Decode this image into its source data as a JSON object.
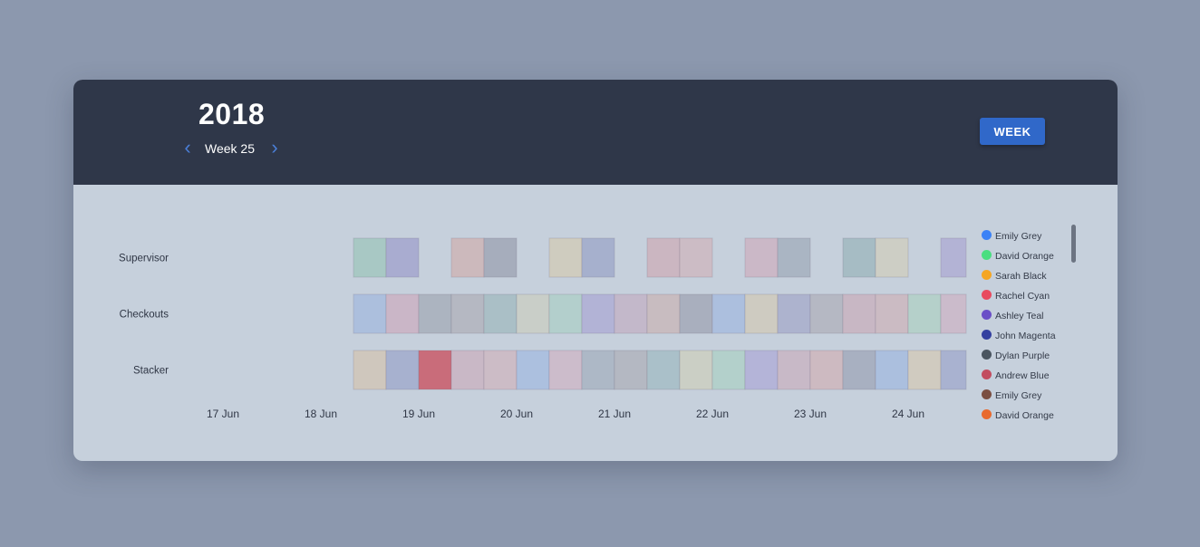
{
  "header": {
    "year": "2018",
    "week_label": "Week 25",
    "prev_icon": "chevron-left-icon",
    "next_icon": "chevron-right-icon",
    "view_button": "WEEK"
  },
  "colors": {
    "background": "#8c98ae",
    "header_bg": "#2f3749",
    "panel_bg": "#c6d0dc",
    "accent": "#3068c9"
  },
  "legend": {
    "items": [
      {
        "name": "Emily Grey",
        "color": "#3b82f6"
      },
      {
        "name": "David Orange",
        "color": "#4ade80"
      },
      {
        "name": "Sarah Black",
        "color": "#f5a623"
      },
      {
        "name": "Rachel Cyan",
        "color": "#e84a5f"
      },
      {
        "name": "Ashley Teal",
        "color": "#6a4fc7"
      },
      {
        "name": "John Magenta",
        "color": "#3440a0"
      },
      {
        "name": "Dylan Purple",
        "color": "#4a5560"
      },
      {
        "name": "Andrew Blue",
        "color": "#c24d60"
      },
      {
        "name": "Emily Grey",
        "color": "#7a4f42"
      },
      {
        "name": "David Orange",
        "color": "#e86a2e"
      }
    ]
  },
  "chart_data": {
    "type": "timeline",
    "x_unit": "hours from 17 Jun 00:00",
    "xlim": [
      0,
      210
    ],
    "x_ticks": [
      {
        "label": "17 Jun",
        "value": 0
      },
      {
        "label": "18 Jun",
        "value": 24
      },
      {
        "label": "19 Jun",
        "value": 48
      },
      {
        "label": "20 Jun",
        "value": 72
      },
      {
        "label": "21 Jun",
        "value": 96
      },
      {
        "label": "22 Jun",
        "value": 120
      },
      {
        "label": "23 Jun",
        "value": 144
      },
      {
        "label": "24 Jun",
        "value": 168
      }
    ],
    "rows": [
      {
        "label": "Supervisor",
        "segments": [
          {
            "start": 32,
            "end": 40,
            "color": "#a8c8c4"
          },
          {
            "start": 40,
            "end": 48,
            "color": "#a9acd0"
          },
          {
            "start": 56,
            "end": 64,
            "color": "#ccb9bc"
          },
          {
            "start": 64,
            "end": 72,
            "color": "#a6adbc"
          },
          {
            "start": 80,
            "end": 88,
            "color": "#cfccbf"
          },
          {
            "start": 88,
            "end": 96,
            "color": "#a6b0cd"
          },
          {
            "start": 104,
            "end": 112,
            "color": "#cbb6c1"
          },
          {
            "start": 112,
            "end": 120,
            "color": "#ccbcc5"
          },
          {
            "start": 128,
            "end": 136,
            "color": "#cbb8c7"
          },
          {
            "start": 136,
            "end": 144,
            "color": "#aab5c3"
          },
          {
            "start": 152,
            "end": 160,
            "color": "#a6bcc4"
          },
          {
            "start": 160,
            "end": 168,
            "color": "#cdcec5"
          },
          {
            "start": 176,
            "end": 184,
            "color": "#b3b3d5"
          },
          {
            "start": 184,
            "end": 186,
            "color": "#ccb4bd"
          }
        ]
      },
      {
        "label": "Checkouts",
        "segments": [
          {
            "start": 32,
            "end": 40,
            "color": "#acbfdd"
          },
          {
            "start": 40,
            "end": 48,
            "color": "#cab6c7"
          },
          {
            "start": 48,
            "end": 56,
            "color": "#acb4c0"
          },
          {
            "start": 56,
            "end": 64,
            "color": "#b5b8c2"
          },
          {
            "start": 64,
            "end": 72,
            "color": "#aabfc6"
          },
          {
            "start": 72,
            "end": 80,
            "color": "#c9cec8"
          },
          {
            "start": 80,
            "end": 88,
            "color": "#b3cfcc"
          },
          {
            "start": 88,
            "end": 96,
            "color": "#b2b3d6"
          },
          {
            "start": 96,
            "end": 104,
            "color": "#c3b8ca"
          },
          {
            "start": 104,
            "end": 112,
            "color": "#c8bcc0"
          },
          {
            "start": 112,
            "end": 120,
            "color": "#a9afbe"
          },
          {
            "start": 120,
            "end": 128,
            "color": "#acbfde"
          },
          {
            "start": 128,
            "end": 136,
            "color": "#cecbc1"
          },
          {
            "start": 136,
            "end": 144,
            "color": "#adb3ce"
          },
          {
            "start": 144,
            "end": 152,
            "color": "#b5b8c3"
          },
          {
            "start": 152,
            "end": 160,
            "color": "#c8b7c4"
          },
          {
            "start": 160,
            "end": 168,
            "color": "#cbbbc3"
          },
          {
            "start": 168,
            "end": 176,
            "color": "#b5d0ca"
          },
          {
            "start": 176,
            "end": 184,
            "color": "#cbbbcb"
          },
          {
            "start": 184,
            "end": 186,
            "color": "#cab7c4"
          }
        ]
      },
      {
        "label": "Stacker",
        "segments": [
          {
            "start": 32,
            "end": 40,
            "color": "#cfc7bd"
          },
          {
            "start": 40,
            "end": 48,
            "color": "#a7b1cf"
          },
          {
            "start": 48,
            "end": 56,
            "color": "#c96c7a"
          },
          {
            "start": 56,
            "end": 64,
            "color": "#c9b8c6"
          },
          {
            "start": 64,
            "end": 72,
            "color": "#ccbcc6"
          },
          {
            "start": 72,
            "end": 80,
            "color": "#acc0df"
          },
          {
            "start": 80,
            "end": 88,
            "color": "#ccbccb"
          },
          {
            "start": 88,
            "end": 96,
            "color": "#adb8c6"
          },
          {
            "start": 96,
            "end": 104,
            "color": "#b4b8c2"
          },
          {
            "start": 104,
            "end": 112,
            "color": "#aac0c9"
          },
          {
            "start": 112,
            "end": 120,
            "color": "#cbcfc5"
          },
          {
            "start": 120,
            "end": 128,
            "color": "#b3d0cb"
          },
          {
            "start": 128,
            "end": 136,
            "color": "#b4b4d8"
          },
          {
            "start": 136,
            "end": 144,
            "color": "#c8b9c7"
          },
          {
            "start": 144,
            "end": 152,
            "color": "#cdbac1"
          },
          {
            "start": 152,
            "end": 160,
            "color": "#a8b0c1"
          },
          {
            "start": 160,
            "end": 168,
            "color": "#abbfde"
          },
          {
            "start": 168,
            "end": 176,
            "color": "#d0cbc0"
          },
          {
            "start": 176,
            "end": 184,
            "color": "#a9b2d0"
          },
          {
            "start": 184,
            "end": 186,
            "color": "#b6b8c2"
          }
        ]
      }
    ]
  }
}
